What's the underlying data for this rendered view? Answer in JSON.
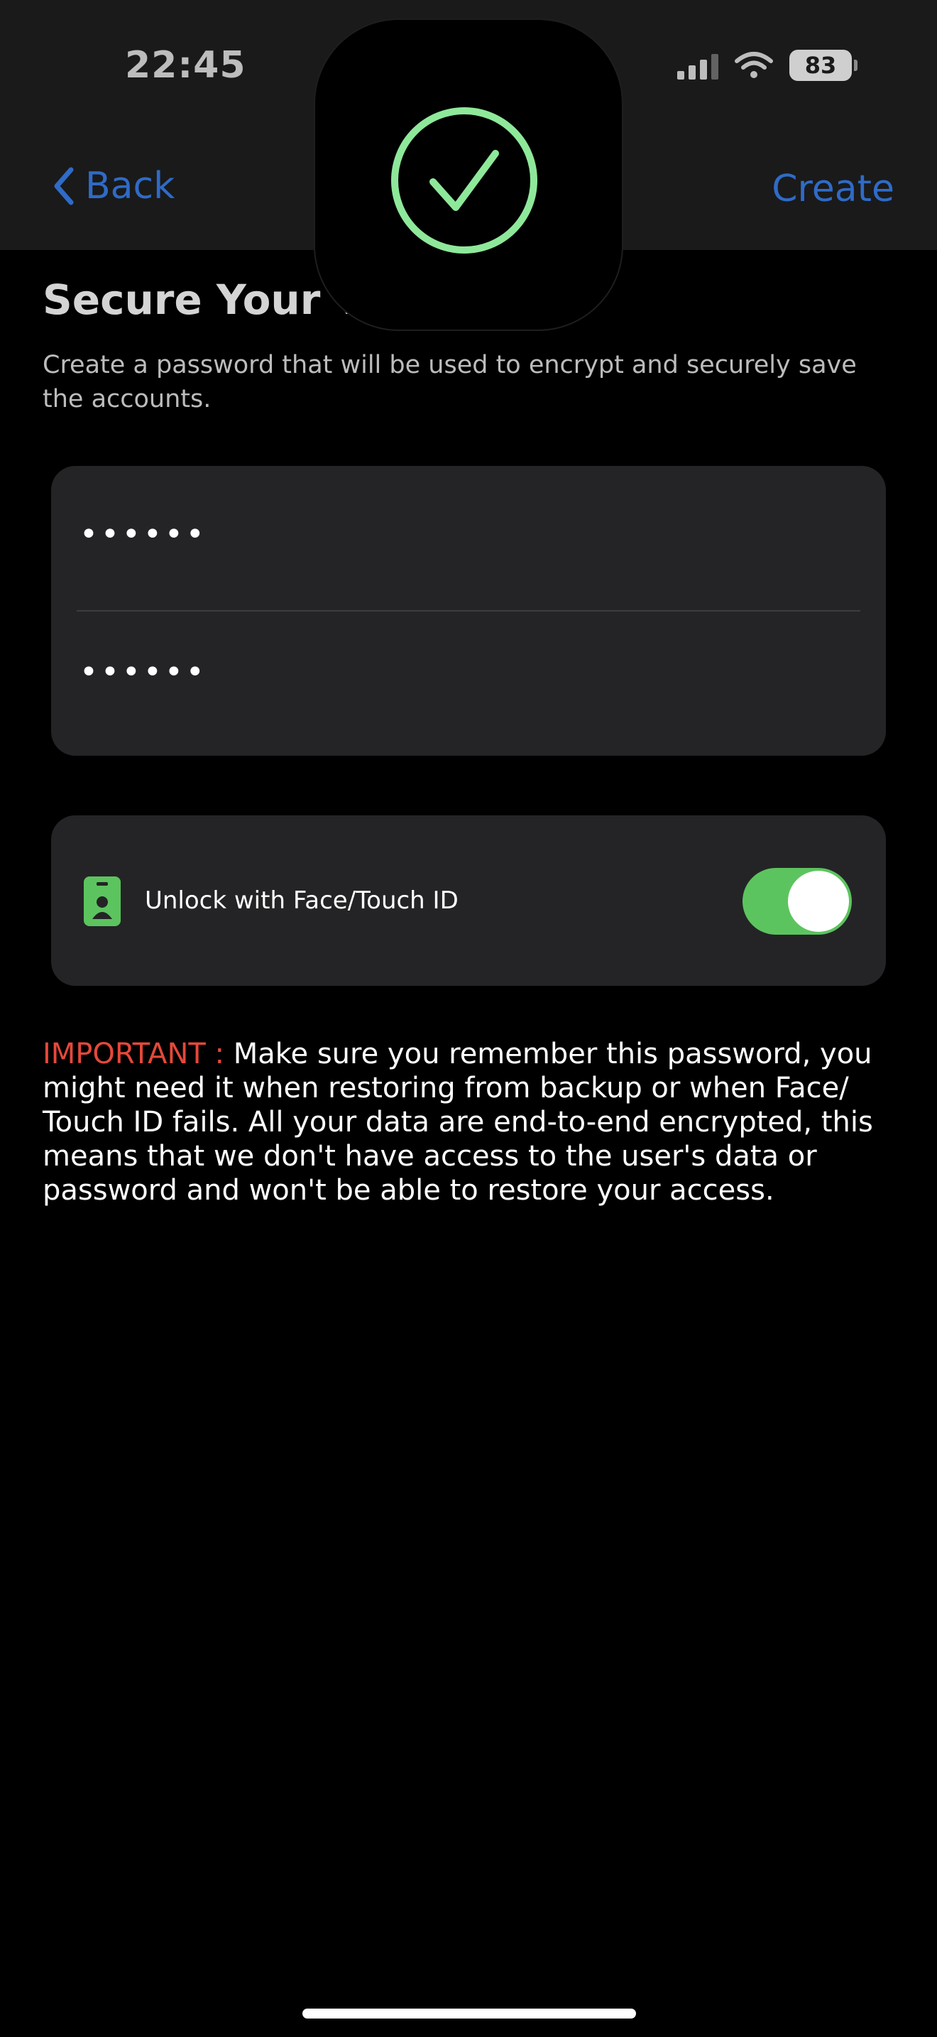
{
  "status_bar": {
    "time": "22:45",
    "battery": "83"
  },
  "nav": {
    "back_label": "Back",
    "create_label": "Create"
  },
  "header": {
    "title": "Secure Your Va",
    "subtitle": "Create a password that will be used to encrypt and securely save the accounts."
  },
  "password_form": {
    "password_value": "••••••",
    "confirm_value": "••••••"
  },
  "biometrics": {
    "label": "Unlock with Face/Touch ID",
    "enabled": true
  },
  "notice": {
    "prefix": "IMPORTANT : ",
    "body": "Make sure you remember this password, you might need it when restoring from backup or when Face/ Touch ID fails. All your data are end-to-end encrypted, this means that we don't have access to the user's data or password and won't be able to restore your access."
  },
  "colors": {
    "accent_blue": "#2f6bc7",
    "toggle_green": "#5cc45e",
    "check_green": "#8ee89a",
    "important_red": "#e5483a",
    "card_bg": "#242426"
  },
  "icons": {
    "back": "chevron-left-icon",
    "biometrics": "id-badge-icon",
    "hud": "checkmark-circle-icon"
  }
}
